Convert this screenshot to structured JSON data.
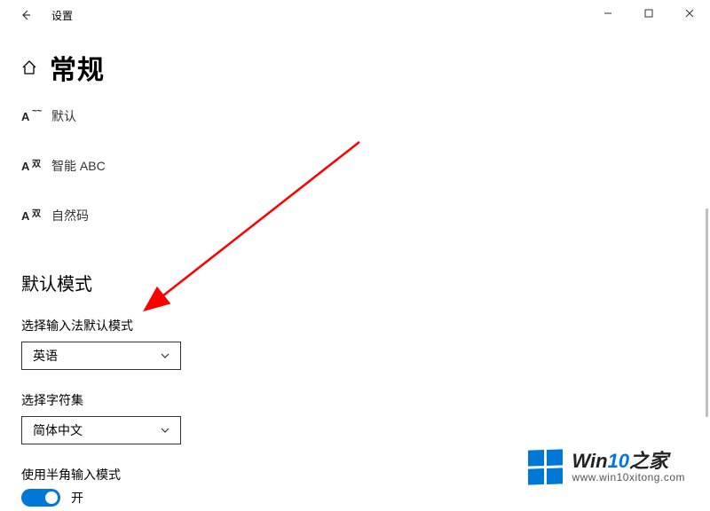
{
  "window": {
    "title": "设置"
  },
  "page": {
    "heading": "常规"
  },
  "ime_items": [
    {
      "glyph_main": "A",
      "glyph_sup": "~~",
      "label": "默认"
    },
    {
      "glyph_main": "A",
      "glyph_sup": "双",
      "label": "智能 ABC"
    },
    {
      "glyph_main": "A",
      "glyph_sup": "双",
      "label": "自然码"
    }
  ],
  "section": {
    "default_mode_title": "默认模式",
    "input_mode_label": "选择输入法默认模式",
    "input_mode_value": "英语",
    "charset_label": "选择字符集",
    "charset_value": "简体中文",
    "halfwidth_label": "使用半角输入模式",
    "halfwidth_state": "开"
  },
  "watermark": {
    "main_a": "Win",
    "main_b": "10",
    "main_c": "之家",
    "sub": "www.win10xitong.com"
  }
}
